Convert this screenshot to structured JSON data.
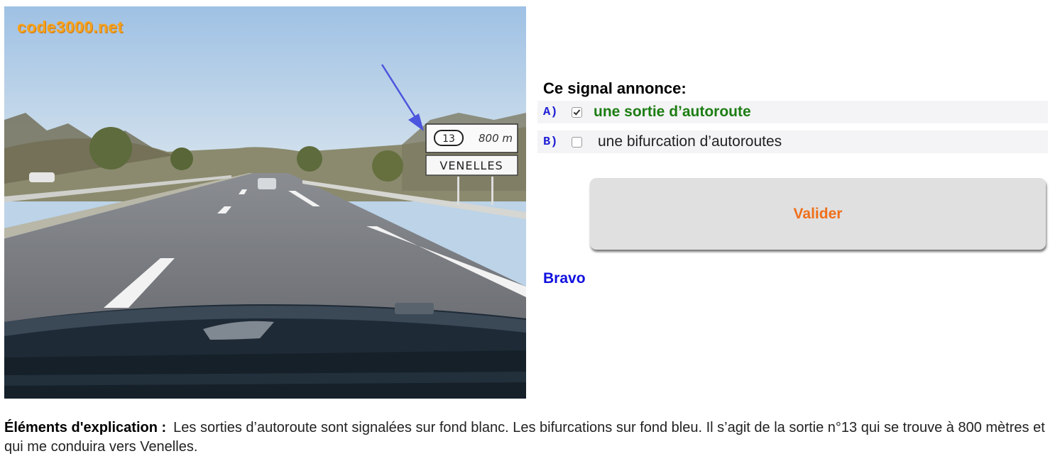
{
  "photo": {
    "watermark": "code3000.net",
    "sign": {
      "exit_number": "13",
      "distance": "800 m",
      "destination": "VENELLES"
    },
    "arrow_color": "#4c55dd"
  },
  "quiz": {
    "question": "Ce signal annonce:",
    "answers": [
      {
        "letter": "A)",
        "text": "une sortie d’autoroute",
        "checked": true,
        "correct": true
      },
      {
        "letter": "B)",
        "text": "une bifurcation d’autoroutes",
        "checked": false,
        "correct": false
      }
    ],
    "validate_label": "Valider",
    "feedback": "Bravo"
  },
  "explanation": {
    "label": "Éléments d'explication :",
    "text": "Les sorties d’autoroute sont signalées sur fond blanc. Les bifurcations sur fond bleu. Il s’agit de la sortie n°13 qui se trouve à 800 mètres et qui me conduira vers Venelles."
  },
  "colors": {
    "correct_answer": "#1d7d13",
    "letter": "#1f1fd6",
    "validate_text": "#f06f1b",
    "feedback": "#1010e0",
    "watermark": "#f7a21b"
  }
}
